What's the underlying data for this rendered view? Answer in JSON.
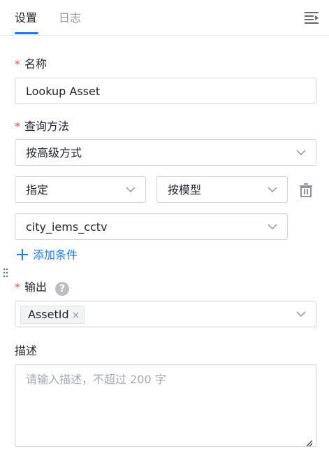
{
  "tabs": [
    {
      "label": "设置",
      "active": true
    },
    {
      "label": "日志",
      "active": false
    }
  ],
  "name_field": {
    "label": "名称",
    "required_mark": "*",
    "value": "Lookup Asset"
  },
  "query_method": {
    "label": "查询方法",
    "required_mark": "*",
    "value": "按高级方式",
    "condition": {
      "type_value": "指定",
      "mode_value": "按模型",
      "target_value": "city_iems_cctv"
    },
    "add_condition_label": "添加条件"
  },
  "output": {
    "label": "输出",
    "required_mark": "*",
    "help": "?",
    "tags": [
      {
        "label": "AssetId",
        "remove": "×"
      }
    ]
  },
  "description": {
    "label": "描述",
    "placeholder": "请输入描述，不超过 200 字"
  },
  "colors": {
    "accent": "#1677ff",
    "required": "#f54a45",
    "border": "#d0d3d6"
  }
}
